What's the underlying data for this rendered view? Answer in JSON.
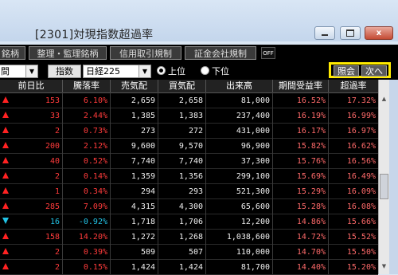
{
  "window": {
    "title": "[2301]対現指数超過率",
    "min_glyph": "",
    "max_glyph": "",
    "close_glyph": "x"
  },
  "tabs": [
    "銘柄",
    "整理・監理銘柄",
    "信用取引規制",
    "証金会社規制"
  ],
  "off_label": "OFF",
  "controls": {
    "period_value": "間",
    "index_label": "指数",
    "index_value": "日経225",
    "radio_up": "上位",
    "radio_down": "下位",
    "radio_selected": "up",
    "lookup_button": "照会",
    "next_button": "次へ"
  },
  "colors": {
    "highlight_border": "#ffea00",
    "up": "#ff3b3b",
    "down": "#22c3e6"
  },
  "columns": [
    "前日比",
    "騰落率",
    "売気配",
    "買気配",
    "出来高",
    "期間受益率",
    "超過率"
  ],
  "rows": [
    {
      "dir": "up",
      "change": "153",
      "rate": "6.10%",
      "ask": "2,659",
      "bid": "2,658",
      "volume": "81,000",
      "period": "16.52%",
      "excess": "17.32%"
    },
    {
      "dir": "up",
      "change": "33",
      "rate": "2.44%",
      "ask": "1,385",
      "bid": "1,383",
      "volume": "237,400",
      "period": "16.19%",
      "excess": "16.99%"
    },
    {
      "dir": "up",
      "change": "2",
      "rate": "0.73%",
      "ask": "273",
      "bid": "272",
      "volume": "431,000",
      "period": "16.17%",
      "excess": "16.97%"
    },
    {
      "dir": "up",
      "change": "200",
      "rate": "2.12%",
      "ask": "9,600",
      "bid": "9,570",
      "volume": "96,900",
      "period": "15.82%",
      "excess": "16.62%"
    },
    {
      "dir": "up",
      "change": "40",
      "rate": "0.52%",
      "ask": "7,740",
      "bid": "7,740",
      "volume": "37,300",
      "period": "15.76%",
      "excess": "16.56%"
    },
    {
      "dir": "up",
      "change": "2",
      "rate": "0.14%",
      "ask": "1,359",
      "bid": "1,356",
      "volume": "299,100",
      "period": "15.69%",
      "excess": "16.49%"
    },
    {
      "dir": "up",
      "change": "1",
      "rate": "0.34%",
      "ask": "294",
      "bid": "293",
      "volume": "521,300",
      "period": "15.29%",
      "excess": "16.09%"
    },
    {
      "dir": "up",
      "change": "285",
      "rate": "7.09%",
      "ask": "4,315",
      "bid": "4,300",
      "volume": "65,600",
      "period": "15.28%",
      "excess": "16.08%"
    },
    {
      "dir": "down",
      "change": "16",
      "rate": "-0.92%",
      "ask": "1,718",
      "bid": "1,706",
      "volume": "12,200",
      "period": "14.86%",
      "excess": "15.66%"
    },
    {
      "dir": "up",
      "change": "158",
      "rate": "14.20%",
      "ask": "1,272",
      "bid": "1,268",
      "volume": "1,038,600",
      "period": "14.72%",
      "excess": "15.52%"
    },
    {
      "dir": "up",
      "change": "2",
      "rate": "0.39%",
      "ask": "509",
      "bid": "507",
      "volume": "110,000",
      "period": "14.70%",
      "excess": "15.50%"
    },
    {
      "dir": "up",
      "change": "2",
      "rate": "0.15%",
      "ask": "1,424",
      "bid": "1,424",
      "volume": "81,700",
      "period": "14.40%",
      "excess": "15.20%"
    }
  ]
}
